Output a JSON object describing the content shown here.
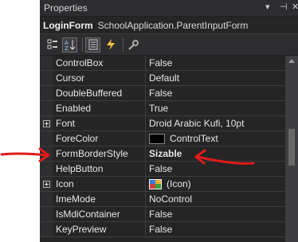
{
  "panel": {
    "title": "Properties"
  },
  "object": {
    "name": "LoginForm",
    "type": "SchoolApplication.ParentInputForm"
  },
  "toolbar": {
    "icons": [
      "categorized-icon",
      "alphabetical-icon",
      "properties-icon",
      "events-icon",
      "property-pages-icon"
    ]
  },
  "rows": [
    {
      "name": "ControlBox",
      "value": "False"
    },
    {
      "name": "Cursor",
      "value": "Default"
    },
    {
      "name": "DoubleBuffered",
      "value": "False"
    },
    {
      "name": "Enabled",
      "value": "True"
    },
    {
      "name": "Font",
      "value": "Droid Arabic Kufi, 10pt"
    },
    {
      "name": "ForeColor",
      "value": "ControlText"
    },
    {
      "name": "FormBorderStyle",
      "value": "Sizable"
    },
    {
      "name": "HelpButton",
      "value": "False"
    },
    {
      "name": "Icon",
      "value": "(Icon)"
    },
    {
      "name": "ImeMode",
      "value": "NoControl"
    },
    {
      "name": "IsMdiContainer",
      "value": "False"
    },
    {
      "name": "KeyPreview",
      "value": "False"
    }
  ],
  "colors": {
    "annotation": "#e01a1a"
  }
}
